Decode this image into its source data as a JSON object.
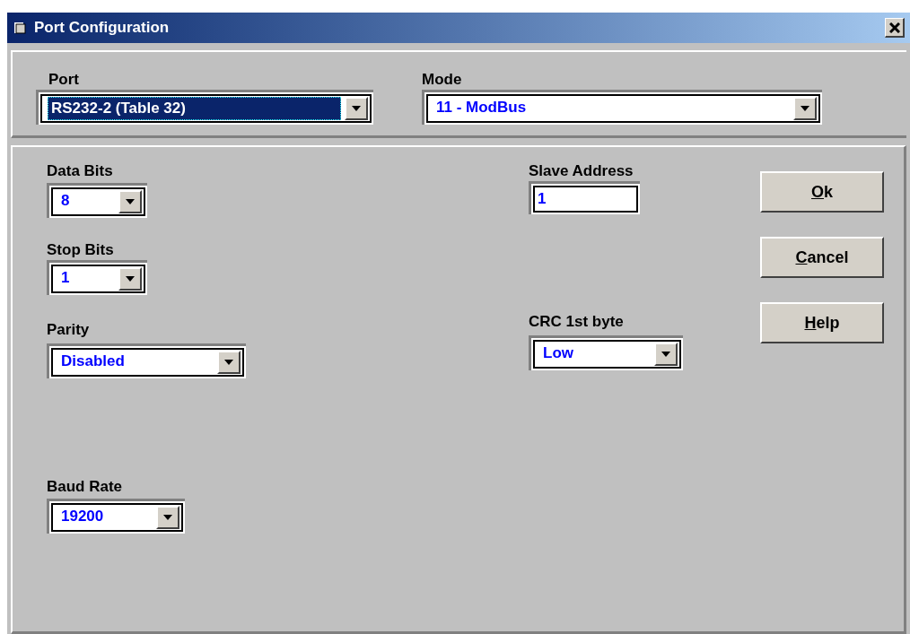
{
  "window": {
    "title": "Port Configuration"
  },
  "port": {
    "label": "Port",
    "value": "RS232-2 (Table 32)",
    "focused": true
  },
  "mode": {
    "label": "Mode",
    "value": "11 - ModBus",
    "focused": false
  },
  "data_bits": {
    "label": "Data Bits",
    "value": "8",
    "focused": false
  },
  "stop_bits": {
    "label": "Stop Bits",
    "value": "1",
    "focused": false
  },
  "parity": {
    "label": "Parity",
    "value": "Disabled",
    "focused": false
  },
  "baud_rate": {
    "label": "Baud Rate",
    "value": "19200",
    "focused": false
  },
  "slave_address": {
    "label": "Slave Address",
    "value": "1"
  },
  "crc_first_byte": {
    "label": "CRC 1st byte",
    "value": "Low",
    "focused": false
  },
  "buttons": [
    {
      "accel_key": "O",
      "label_rest": "k"
    },
    {
      "accel_key": "C",
      "label_rest": "ancel"
    },
    {
      "accel_key": "H",
      "label_rest": "elp"
    }
  ]
}
